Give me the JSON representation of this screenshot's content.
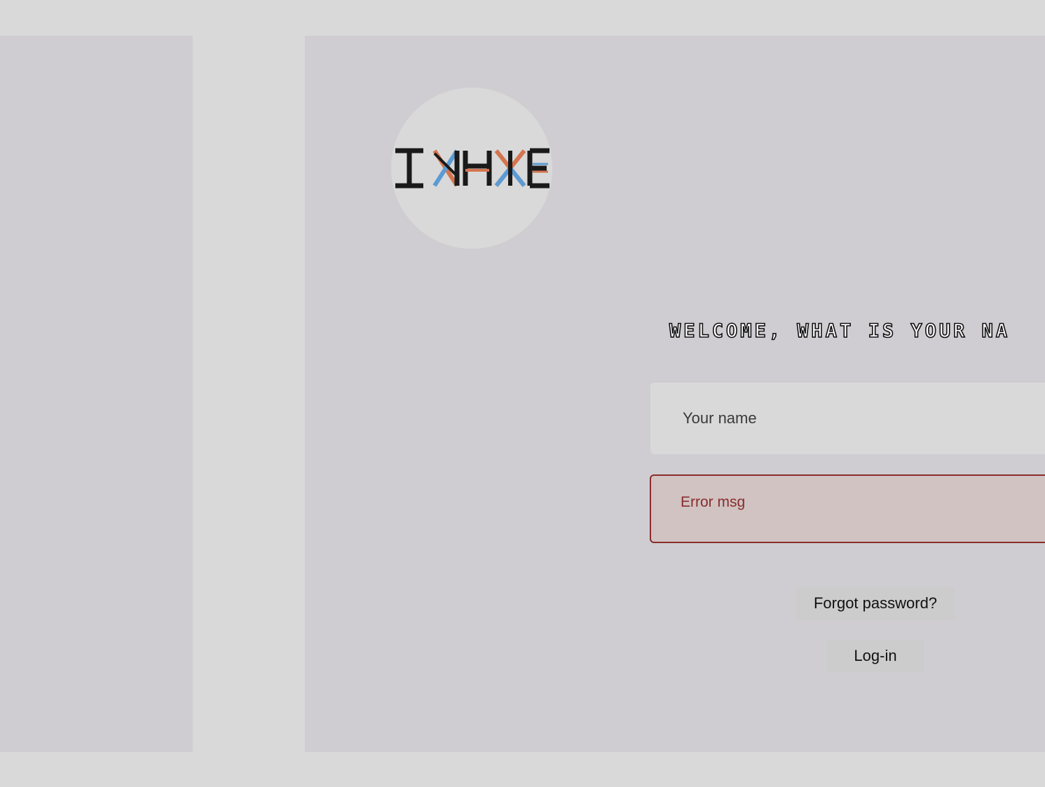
{
  "logo": {
    "text": "INHXE",
    "colors": {
      "ink": "#1a1a1a",
      "orange": "#d4754f",
      "blue": "#5b9bd5"
    }
  },
  "login": {
    "welcome_text": "WELCOME, WHAT IS YOUR NA",
    "name_placeholder": "Your name",
    "error_message": "Error msg",
    "forgot_password_label": "Forgot password?",
    "login_label": "Log-in"
  },
  "colors": {
    "page_bg": "#d9d9d9",
    "panel_bg": "#cfcdd1",
    "error_border": "#8a2c2c",
    "error_bg": "#d0c3c2"
  }
}
